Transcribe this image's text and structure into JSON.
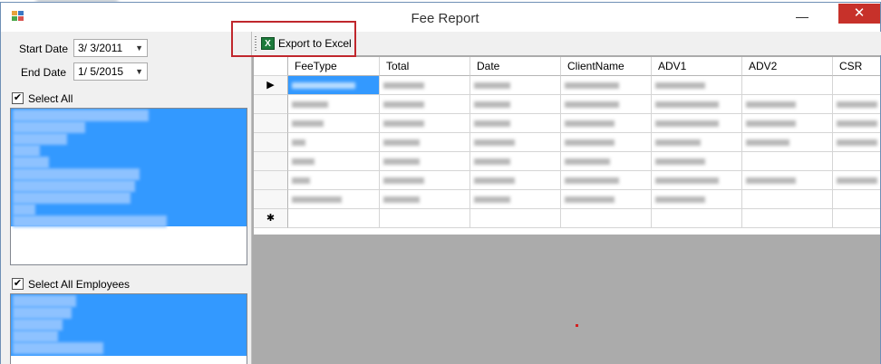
{
  "window": {
    "title": "Fee Report",
    "minimize_glyph": "—",
    "close_glyph": "✕"
  },
  "filters": {
    "start_date_label": "Start Date",
    "start_date_value": "3/ 3/2011",
    "end_date_label": "End Date",
    "end_date_value": "1/ 5/2015",
    "select_all_label": "Select All",
    "select_all_checked": true,
    "select_all_employees_label": "Select All Employees",
    "select_all_employees_checked": true,
    "check_glyph": "✔",
    "dropdown_glyph": "▼"
  },
  "toolbar": {
    "export_label": "Export to Excel",
    "excel_icon_glyph": "X"
  },
  "grid": {
    "columns": [
      "FeeType",
      "Total",
      "Date",
      "ClientName",
      "ADV1",
      "ADV2",
      "CSR"
    ],
    "current_row_glyph": "▶",
    "new_row_glyph": "✱"
  },
  "colors": {
    "selection": "#3399ff",
    "close_button": "#c7312a",
    "highlight_border": "#c0272d",
    "grid_background": "#ababab"
  }
}
